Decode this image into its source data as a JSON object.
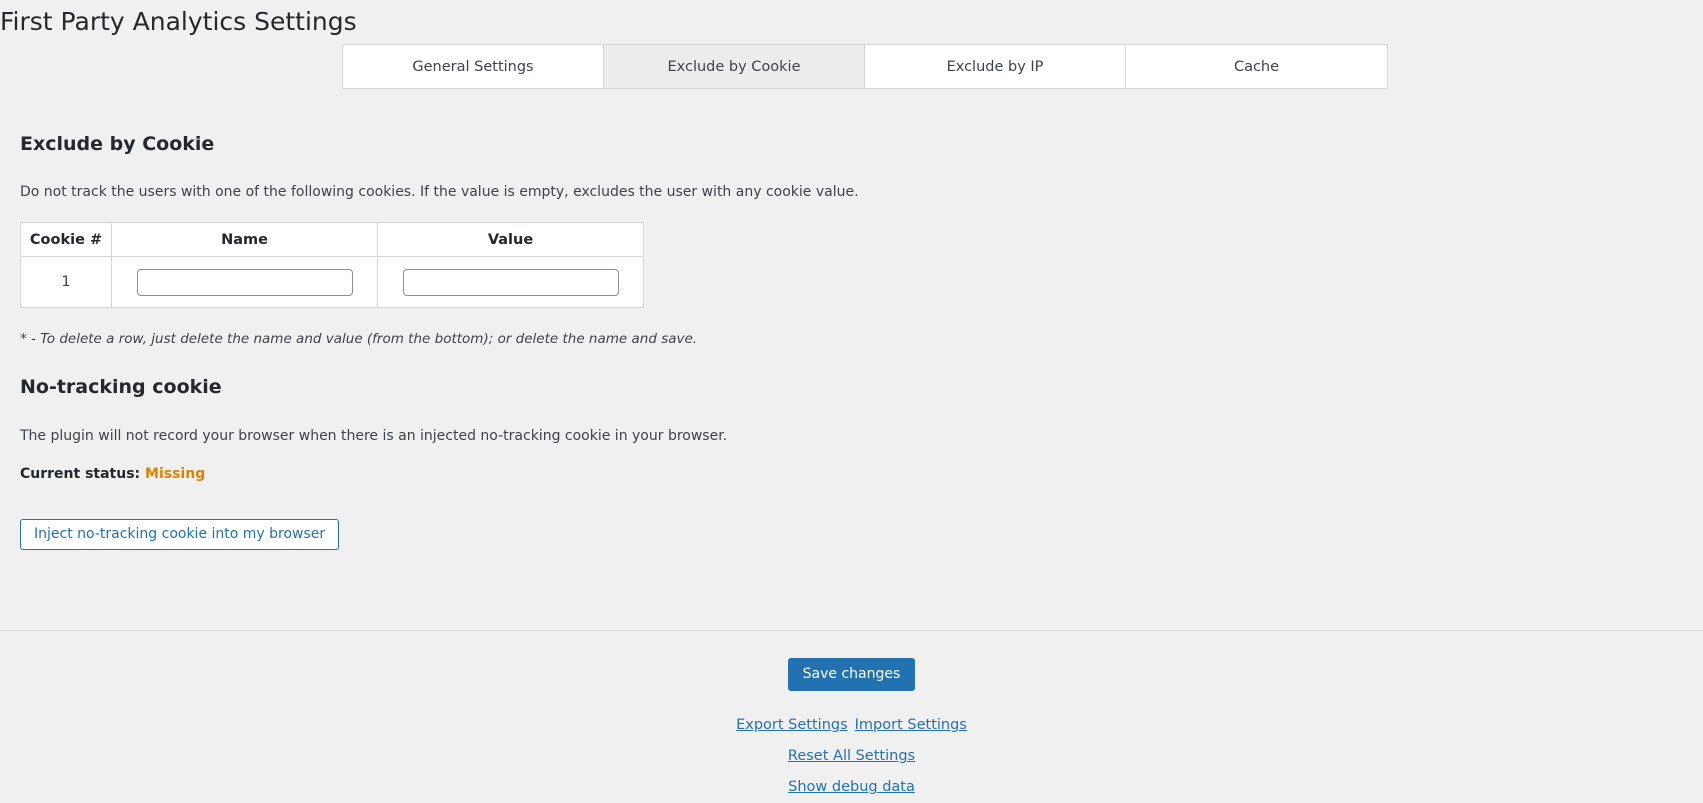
{
  "page": {
    "title": "First Party Analytics Settings",
    "background_color": "#f0f0f0"
  },
  "tabs": {
    "items": [
      {
        "label": "General Settings",
        "active": false
      },
      {
        "label": "Exclude by Cookie",
        "active": true
      },
      {
        "label": "Exclude by IP",
        "active": false
      },
      {
        "label": "Cache",
        "active": false
      }
    ]
  },
  "exclude_by_cookie": {
    "heading": "Exclude by Cookie",
    "description": "Do not track the users with one of the following cookies. If the value is empty, excludes the user with any cookie value.",
    "table": {
      "columns": [
        "Cookie #",
        "Name",
        "Value"
      ],
      "rows": [
        {
          "index": "1",
          "name_value": "",
          "name_placeholder": "",
          "value_value": "",
          "value_placeholder": ""
        }
      ]
    },
    "note": "* - To delete a row, just delete the name and value (from the bottom); or delete the name and save."
  },
  "no_tracking_cookie": {
    "heading": "No-tracking cookie",
    "description": "The plugin will not record your browser when there is an injected no-tracking cookie in your browser.",
    "status_label": "Current status:",
    "status_value": "Missing",
    "status_color": "#e08000",
    "inject_button_label": "Inject no-tracking cookie into my browser"
  },
  "footer": {
    "save_label": "Save changes",
    "save_color": "#2271b1",
    "links": {
      "export": "Export Settings",
      "import": "Import Settings",
      "reset": "Reset All Settings",
      "debug": "Show debug data"
    }
  }
}
